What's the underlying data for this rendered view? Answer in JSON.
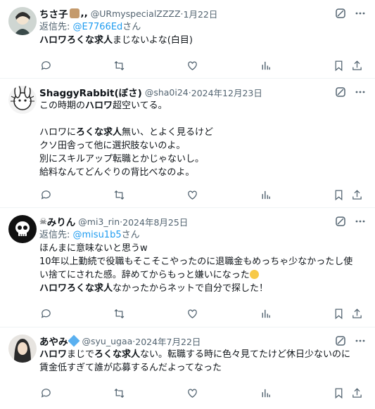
{
  "tweets": [
    {
      "name": "ちさ子",
      "name_suffix": ",,",
      "handle": "@URmyspecialZZZZ",
      "date": "1月22日",
      "reply_prefix": "返信先: ",
      "reply_handle": "@E7766Ed",
      "reply_suffix": "さん",
      "lines": [
        [
          {
            "t": "ハロワろくな求人",
            "b": true
          },
          {
            "t": "まじないよな(白目)"
          }
        ]
      ]
    },
    {
      "name": "ShaggyRabbit(ぼさ)",
      "handle": "@sha0i24",
      "date": "2024年12月23日",
      "lines": [
        [
          {
            "t": "この時期の"
          },
          {
            "t": "ハロワ",
            "b": true
          },
          {
            "t": "超空いてる。"
          }
        ],
        [],
        [
          {
            "t": "ハロワに"
          },
          {
            "t": "ろくな求人",
            "b": true
          },
          {
            "t": "無い、とよく見るけど"
          }
        ],
        [
          {
            "t": "クソ田舎って他に選択肢ないのよ。"
          }
        ],
        [
          {
            "t": "別にスキルアップ転職とかじゃないし。"
          }
        ],
        [
          {
            "t": "給料なんてどんぐりの背比べなのよ。"
          }
        ]
      ]
    },
    {
      "name_prefix": "☠",
      "name": "みりん",
      "handle": "@mi3_rin",
      "date": "2024年8月25日",
      "reply_prefix": "返信先: ",
      "reply_handle": "@misu1b5",
      "reply_suffix": "さん",
      "lines": [
        [
          {
            "t": "ほんまに意味ないと思うw"
          }
        ],
        [
          {
            "t": "10年以上勤続で役職もそこそこやったのに退職金もめっちゃ少なかったし使"
          }
        ],
        [
          {
            "t": "い捨てにされた感。辞めてからもっと嫌いになった"
          }
        ],
        [
          {
            "t": "ハロワろくな求人",
            "b": true
          },
          {
            "t": "なかったからネットで自分で探した！"
          }
        ]
      ]
    },
    {
      "name": "あやみ",
      "handle": "@syu_ugaa",
      "date": "2024年7月22日",
      "lines": [
        [
          {
            "t": "ハロワ",
            "b": true
          },
          {
            "t": "まじで"
          },
          {
            "t": "ろくな求人",
            "b": true
          },
          {
            "t": "ない。転職する時に色々見てたけど休日少ないのに"
          }
        ],
        [
          {
            "t": "賃金低すぎて誰が応募するんだよってなった"
          }
        ]
      ]
    }
  ],
  "meta_separator": " · ",
  "icons": {
    "grok": "grok-icon",
    "more": "more-icon",
    "reply": "reply-icon",
    "retweet": "retweet-icon",
    "like": "like-icon",
    "views": "views-icon",
    "bookmark": "bookmark-icon",
    "share": "share-icon"
  },
  "colors": {
    "text": "#0f1419",
    "secondary": "#536471",
    "link": "#1d9bf0",
    "divider": "#eff3f4"
  }
}
